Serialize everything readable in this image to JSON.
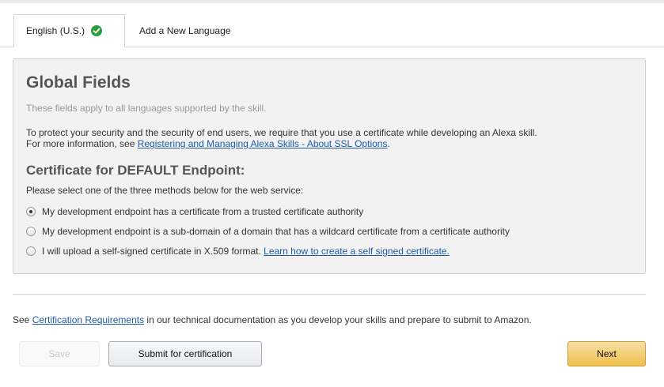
{
  "tabs": {
    "active_label": "English (U.S.)",
    "inactive_label": "Add a New Language"
  },
  "panel": {
    "title": "Global Fields",
    "subtitle": "These fields apply to all languages supported by the skill.",
    "info_line1": "To protect your security and the security of end users, we require that you use a certificate while developing an Alexa skill.",
    "info_line2_prefix": "For more information, see ",
    "info_line2_link": "Registering and Managing Alexa Skills - About SSL Options",
    "info_line2_suffix": ".",
    "cert_heading": "Certificate for DEFAULT Endpoint:",
    "cert_desc": "Please select one of the three methods below for the web service:",
    "options": [
      {
        "label": "My development endpoint has a certificate from a trusted certificate authority",
        "selected": true
      },
      {
        "label": "My development endpoint is a sub-domain of a domain that has a wildcard certificate from a certificate authority",
        "selected": false
      },
      {
        "label": "I will upload a self-signed certificate in X.509 format. ",
        "link": "Learn how to create a self signed certificate.",
        "selected": false
      }
    ]
  },
  "footer": {
    "prefix": "See ",
    "link": "Certification Requirements",
    "suffix": " in our technical documentation as you develop your skills and prepare to submit to Amazon."
  },
  "buttons": {
    "save": "Save",
    "submit": "Submit for certification",
    "next": "Next"
  },
  "colors": {
    "accent_next": "#f0c14b",
    "link": "#1f5aa6",
    "check": "#2a9d3a"
  }
}
